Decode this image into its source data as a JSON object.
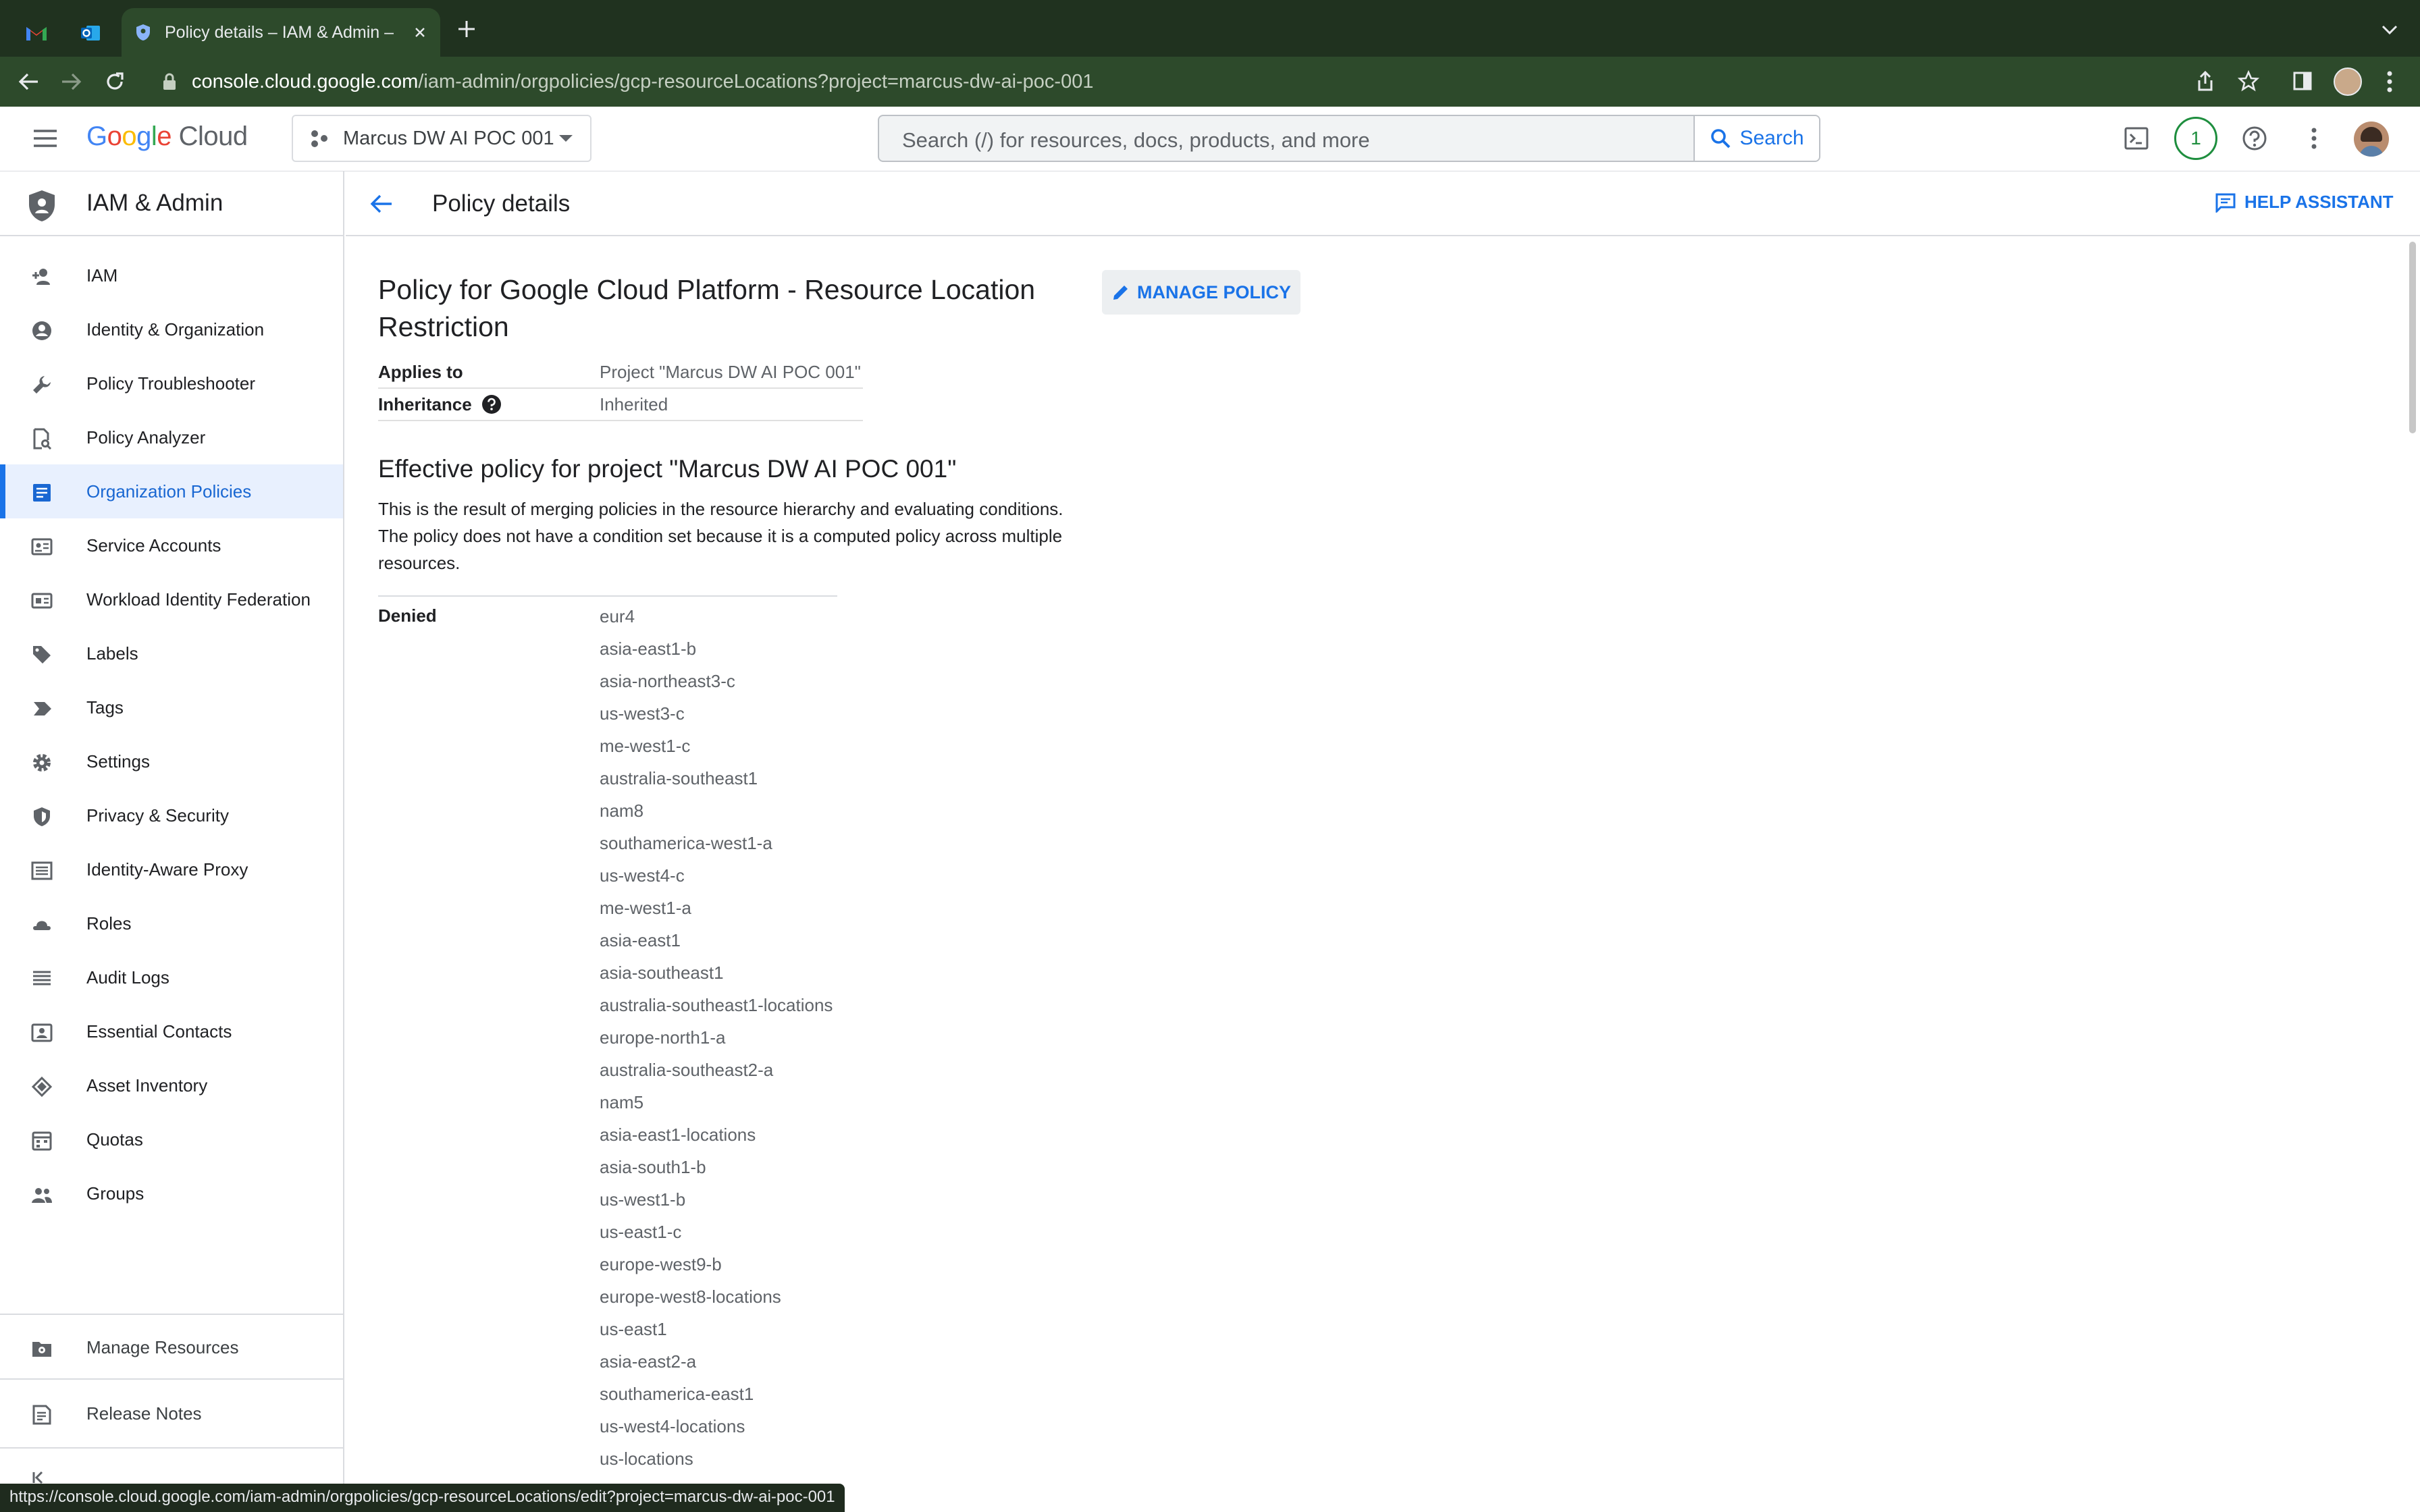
{
  "browser": {
    "tab_title": "Policy details – IAM & Admin –",
    "url_host": "console.cloud.google.com",
    "url_path": "/iam-admin/orgpolicies/gcp-resourceLocations?project=marcus-dw-ai-poc-001",
    "status_url": "https://console.cloud.google.com/iam-admin/orgpolicies/gcp-resourceLocations/edit?project=marcus-dw-ai-poc-001"
  },
  "header": {
    "logo_text": "Google Cloud",
    "project_name": "Marcus DW AI POC 001",
    "search_placeholder": "Search (/) for resources, docs, products, and more",
    "search_button": "Search",
    "notification_count": "1"
  },
  "sidebar": {
    "title": "IAM & Admin",
    "items": [
      {
        "label": "IAM",
        "icon": "person-add-icon"
      },
      {
        "label": "Identity & Organization",
        "icon": "account-circle-icon"
      },
      {
        "label": "Policy Troubleshooter",
        "icon": "wrench-icon"
      },
      {
        "label": "Policy Analyzer",
        "icon": "document-search-icon"
      },
      {
        "label": "Organization Policies",
        "icon": "article-icon",
        "active": true
      },
      {
        "label": "Service Accounts",
        "icon": "service-account-icon"
      },
      {
        "label": "Workload Identity Federation",
        "icon": "id-card-icon"
      },
      {
        "label": "Labels",
        "icon": "label-tag-icon"
      },
      {
        "label": "Tags",
        "icon": "tag-arrow-icon"
      },
      {
        "label": "Settings",
        "icon": "gear-icon"
      },
      {
        "label": "Privacy & Security",
        "icon": "shield-icon"
      },
      {
        "label": "Identity-Aware Proxy",
        "icon": "proxy-icon"
      },
      {
        "label": "Roles",
        "icon": "hat-icon"
      },
      {
        "label": "Audit Logs",
        "icon": "list-icon"
      },
      {
        "label": "Essential Contacts",
        "icon": "contact-card-icon"
      },
      {
        "label": "Asset Inventory",
        "icon": "diamond-layers-icon"
      },
      {
        "label": "Quotas",
        "icon": "calendar-grid-icon"
      },
      {
        "label": "Groups",
        "icon": "people-icon"
      }
    ],
    "footer": [
      {
        "label": "Manage Resources",
        "icon": "settings-folder-icon"
      },
      {
        "label": "Release Notes",
        "icon": "notes-icon"
      }
    ]
  },
  "page": {
    "title": "Policy details",
    "help_assistant": "HELP ASSISTANT",
    "policy_title": "Policy for Google Cloud Platform - Resource Location Restriction",
    "manage_policy": "MANAGE POLICY",
    "applies_to_label": "Applies to",
    "applies_to_value": "Project \"Marcus DW AI POC 001\"",
    "inheritance_label": "Inheritance",
    "inheritance_value": "Inherited",
    "effective_heading": "Effective policy for project \"Marcus DW AI POC 001\"",
    "effective_desc": "This is the result of merging policies in the resource hierarchy and evaluating conditions. The policy does not have a condition set because it is a computed policy across multiple resources.",
    "denied_label": "Denied",
    "denied_locations": [
      "eur4",
      "asia-east1-b",
      "asia-northeast3-c",
      "us-west3-c",
      "me-west1-c",
      "australia-southeast1",
      "nam8",
      "southamerica-west1-a",
      "us-west4-c",
      "me-west1-a",
      "asia-east1",
      "asia-southeast1",
      "australia-southeast1-locations",
      "europe-north1-a",
      "australia-southeast2-a",
      "nam5",
      "asia-east1-locations",
      "asia-south1-b",
      "us-west1-b",
      "us-east1-c",
      "europe-west9-b",
      "europe-west8-locations",
      "us-east1",
      "asia-east2-a",
      "southamerica-east1",
      "us-west4-locations",
      "us-locations"
    ]
  },
  "colors": {
    "accent": "#1a73e8",
    "active_bg": "#e8f0fe",
    "chrome_dark": "#20321f",
    "chrome_toolbar": "#2d4a2b"
  }
}
